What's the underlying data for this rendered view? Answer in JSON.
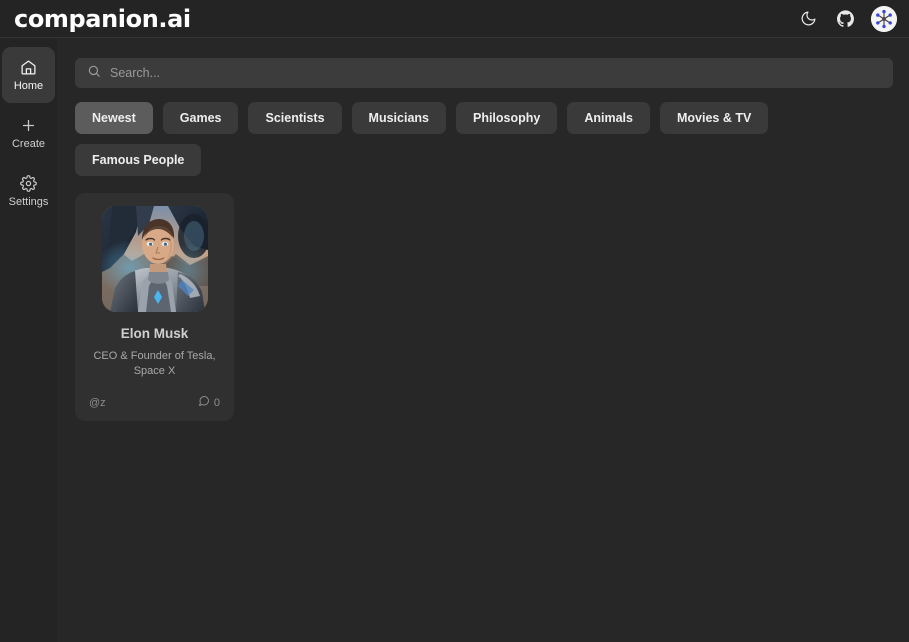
{
  "app": {
    "logo": "companion.ai",
    "theme_toggle_icon": "moon-icon",
    "github_icon": "github-icon",
    "avatar_icon": "user-avatar"
  },
  "sidebar": {
    "items": [
      {
        "label": "Home",
        "icon": "home-icon",
        "active": true
      },
      {
        "label": "Create",
        "icon": "plus-icon",
        "active": false
      },
      {
        "label": "Settings",
        "icon": "gear-icon",
        "active": false
      }
    ]
  },
  "search": {
    "placeholder": "Search...",
    "value": "",
    "icon": "search-icon"
  },
  "categories": {
    "items": [
      {
        "label": "Newest",
        "active": true
      },
      {
        "label": "Games",
        "active": false
      },
      {
        "label": "Scientists",
        "active": false
      },
      {
        "label": "Musicians",
        "active": false
      },
      {
        "label": "Philosophy",
        "active": false
      },
      {
        "label": "Animals",
        "active": false
      },
      {
        "label": "Movies & TV",
        "active": false
      },
      {
        "label": "Famous People",
        "active": false
      }
    ]
  },
  "cards": [
    {
      "name": "Elon Musk",
      "description": "CEO & Founder of Tesla, Space X",
      "username": "@z",
      "message_count": "0",
      "message_icon": "chat-bubble-icon",
      "image_alt": "elon-musk-portrait"
    }
  ],
  "colors": {
    "app_background": "#262626",
    "sidebar_background": "#242424",
    "topbar_background": "#242424",
    "main_background": "#272727",
    "search_background": "#3c3c3c",
    "pill_background": "#3a3a3a",
    "pill_active_background": "#5c5c5c",
    "card_background": "#303030",
    "text_primary": "#eeeeee",
    "text_secondary": "#a9a9a9",
    "text_muted": "#8e8e8e"
  }
}
